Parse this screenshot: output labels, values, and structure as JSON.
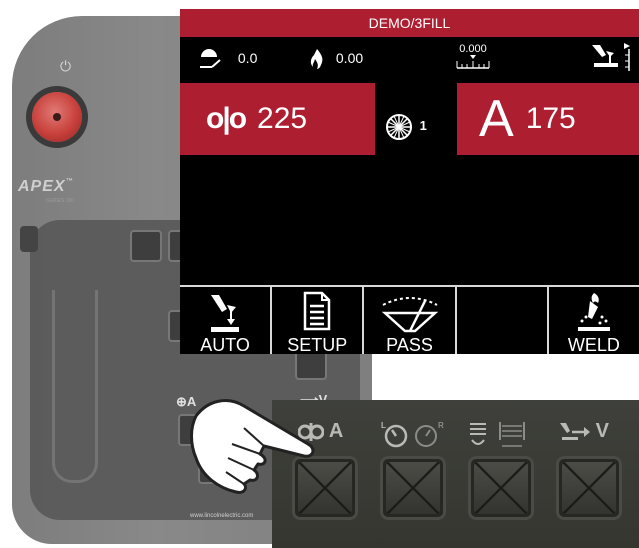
{
  "device": {
    "brand_logo": "APEX",
    "brand_mark": "™",
    "model_text": "SERIES 100",
    "url": "www.lincolnelectric.com",
    "power_icon": "power-icon",
    "estop_icon": "emergency-stop-button",
    "labels": {
      "wfs_amp": "⊕A",
      "voltage": "⟶V"
    }
  },
  "screen": {
    "title": "DEMO/3FILL",
    "colors": {
      "accent": "#ad1e31",
      "background": "#000000",
      "text": "#ffffff"
    },
    "status": {
      "travel_speed": {
        "icon": "travel-speed-icon",
        "value": "0.0"
      },
      "heat_input": {
        "icon": "flame-icon",
        "value": "0.00"
      },
      "oscillation": {
        "icon": "oscillation-position-icon",
        "value": "0.000"
      },
      "auto_mode": {
        "icon": "auto-torch-icon"
      }
    },
    "wire_feed": {
      "icon": "wire-feed-icon",
      "icon_text": "o|o",
      "value": "225"
    },
    "pass": {
      "icon": "wire-reel-icon",
      "value": "1"
    },
    "amperage": {
      "letter": "A",
      "value": "175"
    },
    "softkeys": [
      {
        "label": "AUTO",
        "icon": "auto-torch-icon"
      },
      {
        "label": "SETUP",
        "icon": "document-icon"
      },
      {
        "label": "PASS",
        "icon": "pass-gauge-icon"
      },
      {
        "label": "",
        "icon": ""
      },
      {
        "label": "WELD",
        "icon": "weld-torch-icon"
      }
    ]
  },
  "keypad": {
    "labels": [
      {
        "text": "A",
        "prefix_icon": "wire-feed-icon"
      },
      {
        "text": "",
        "icon": "timer-icon"
      },
      {
        "text": "",
        "icon": "oscillation-width-icon"
      },
      {
        "text": "V",
        "prefix_icon": "auto-torch-icon"
      }
    ],
    "timer_sub": {
      "left": "L",
      "right": "R"
    }
  },
  "hand_icon": "pointing-hand-icon"
}
